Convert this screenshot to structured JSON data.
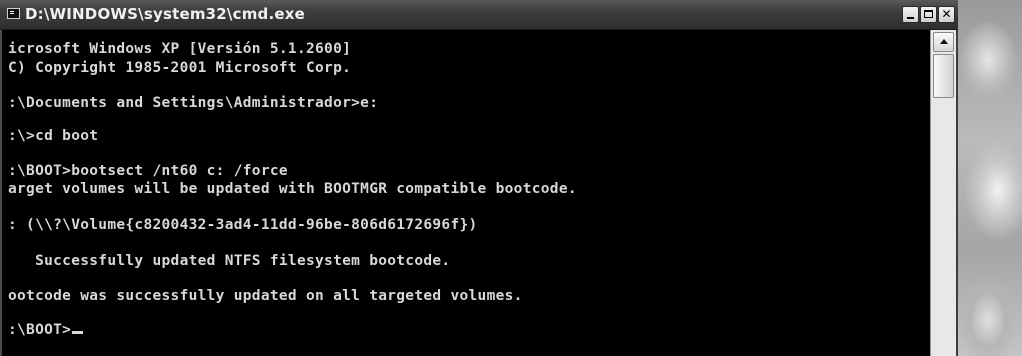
{
  "window": {
    "title": "D:\\WINDOWS\\system32\\cmd.exe",
    "icons": {
      "app": "console-icon",
      "minimize": "minimize-icon",
      "maximize": "maximize-icon",
      "close": "close-icon"
    },
    "close_glyph": "✕"
  },
  "console": {
    "lines": [
      "icrosoft Windows XP [Versión 5.1.2600]",
      "C) Copyright 1985-2001 Microsoft Corp.",
      ":\\Documents and Settings\\Administrador>e:",
      ":\\>cd boot",
      ":\\BOOT>bootsect /nt60 c: /force",
      "arget volumes will be updated with BOOTMGR compatible bootcode.",
      ": (\\\\?\\Volume{c8200432-3ad4-11dd-96be-806d6172696f})",
      "   Successfully updated NTFS filesystem bootcode.",
      "ootcode was successfully updated on all targeted volumes.",
      ":\\BOOT>"
    ]
  },
  "colors": {
    "console_background": "#000000",
    "console_text": "#d8d8d8",
    "titlebar": "#3e3e3e"
  }
}
